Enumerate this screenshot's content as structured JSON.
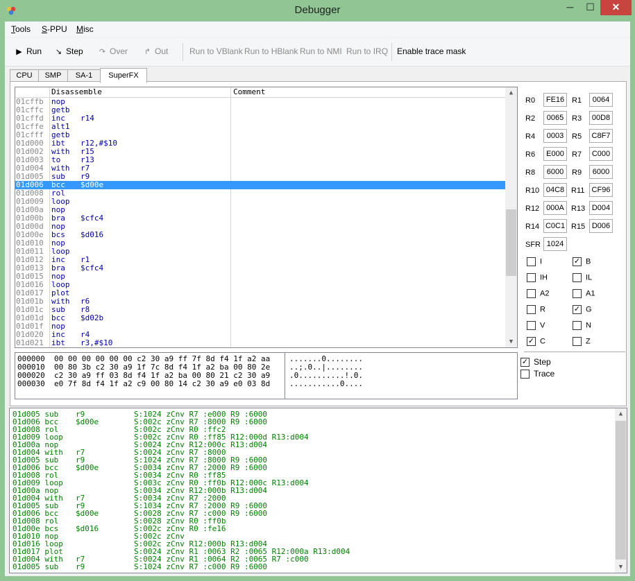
{
  "window": {
    "title": "Debugger",
    "min": "─",
    "max": "☐",
    "close": "✕"
  },
  "menu": [
    {
      "label": "Tools",
      "key": "T",
      "rest": "ools"
    },
    {
      "label": "S-PPU",
      "key": "S",
      "rest": "-PPU"
    },
    {
      "label": "Misc",
      "key": "M",
      "rest": "isc"
    }
  ],
  "toolbar": [
    {
      "label": "Run",
      "icon": "play-icon",
      "glyph": "▶",
      "enabled": true
    },
    {
      "label": "Step",
      "icon": "step-icon",
      "glyph": "↘",
      "enabled": true
    },
    {
      "label": "Over",
      "icon": "step-over-icon",
      "glyph": "↷",
      "enabled": false
    },
    {
      "label": "Out",
      "icon": "step-out-icon",
      "glyph": "↱",
      "enabled": false
    },
    {
      "label": "Run to VBlank",
      "enabled": false
    },
    {
      "label": "Run to HBlank",
      "enabled": false
    },
    {
      "label": "Run to NMI",
      "enabled": false
    },
    {
      "label": "Run to IRQ",
      "enabled": false
    },
    {
      "label": "Enable trace mask",
      "enabled": true
    }
  ],
  "tabs": [
    "CPU",
    "SMP",
    "SA-1",
    "SuperFX"
  ],
  "active_tab": "SuperFX",
  "disassembly": {
    "columns": [
      "Disassemble",
      "Comment"
    ],
    "selected_index": 10,
    "rows": [
      {
        "addr": "01cffb",
        "mn": "nop",
        "op": ""
      },
      {
        "addr": "01cffc",
        "mn": "getb",
        "op": ""
      },
      {
        "addr": "01cffd",
        "mn": "inc",
        "op": "r14"
      },
      {
        "addr": "01cffe",
        "mn": "alt1",
        "op": ""
      },
      {
        "addr": "01cfff",
        "mn": "getb",
        "op": ""
      },
      {
        "addr": "01d000",
        "mn": "ibt",
        "op": "r12,#$10"
      },
      {
        "addr": "01d002",
        "mn": "with",
        "op": "r15"
      },
      {
        "addr": "01d003",
        "mn": "to",
        "op": "r13"
      },
      {
        "addr": "01d004",
        "mn": "with",
        "op": "r7"
      },
      {
        "addr": "01d005",
        "mn": "sub",
        "op": "r9"
      },
      {
        "addr": "01d006",
        "mn": "bcc",
        "op": "$d00e"
      },
      {
        "addr": "01d008",
        "mn": "rol",
        "op": ""
      },
      {
        "addr": "01d009",
        "mn": "loop",
        "op": ""
      },
      {
        "addr": "01d00a",
        "mn": "nop",
        "op": ""
      },
      {
        "addr": "01d00b",
        "mn": "bra",
        "op": "$cfc4"
      },
      {
        "addr": "01d00d",
        "mn": "nop",
        "op": ""
      },
      {
        "addr": "01d00e",
        "mn": "bcs",
        "op": "$d016"
      },
      {
        "addr": "01d010",
        "mn": "nop",
        "op": ""
      },
      {
        "addr": "01d011",
        "mn": "loop",
        "op": ""
      },
      {
        "addr": "01d012",
        "mn": "inc",
        "op": "r1"
      },
      {
        "addr": "01d013",
        "mn": "bra",
        "op": "$cfc4"
      },
      {
        "addr": "01d015",
        "mn": "nop",
        "op": ""
      },
      {
        "addr": "01d016",
        "mn": "loop",
        "op": ""
      },
      {
        "addr": "01d017",
        "mn": "plot",
        "op": ""
      },
      {
        "addr": "01d01b",
        "mn": "with",
        "op": "r6"
      },
      {
        "addr": "01d01c",
        "mn": "sub",
        "op": "r8"
      },
      {
        "addr": "01d01d",
        "mn": "bcc",
        "op": "$d02b"
      },
      {
        "addr": "01d01f",
        "mn": "nop",
        "op": ""
      },
      {
        "addr": "01d020",
        "mn": "inc",
        "op": "r4"
      },
      {
        "addr": "01d021",
        "mn": "ibt",
        "op": "r3,#$10"
      }
    ]
  },
  "hexdump": [
    {
      "hex": "000000  00 00 00 00 00 00 c2 30 a9 ff 7f 8d f4 1f a2 aa",
      "ascii": ".......0........"
    },
    {
      "hex": "000010  00 80 3b c2 30 a9 1f 7c 8d f4 1f a2 ba 00 80 2e",
      "ascii": "..;.0..|........"
    },
    {
      "hex": "000020  c2 30 a9 ff 03 8d f4 1f a2 ba 00 80 21 c2 30 a9",
      "ascii": ".0..........!.0."
    },
    {
      "hex": "000030  e0 7f 8d f4 1f a2 c9 00 80 14 c2 30 a9 e0 03 8d",
      "ascii": "...........0...."
    }
  ],
  "registers": [
    [
      "R0",
      "FE16"
    ],
    [
      "R1",
      "0064"
    ],
    [
      "R2",
      "0065"
    ],
    [
      "R3",
      "00D8"
    ],
    [
      "R4",
      "0003"
    ],
    [
      "R5",
      "C8F7"
    ],
    [
      "R6",
      "E000"
    ],
    [
      "R7",
      "C000"
    ],
    [
      "R8",
      "6000"
    ],
    [
      "R9",
      "6000"
    ],
    [
      "R10",
      "04C8"
    ],
    [
      "R11",
      "CF96"
    ],
    [
      "R12",
      "000A"
    ],
    [
      "R13",
      "D004"
    ],
    [
      "R14",
      "C0C1"
    ],
    [
      "R15",
      "D006"
    ]
  ],
  "sfr": {
    "label": "SFR",
    "value": "1024"
  },
  "flags": [
    {
      "label": "I",
      "checked": false
    },
    {
      "label": "B",
      "checked": true
    },
    {
      "label": "IH",
      "checked": false
    },
    {
      "label": "IL",
      "checked": false
    },
    {
      "label": "A2",
      "checked": false
    },
    {
      "label": "A1",
      "checked": false
    },
    {
      "label": "R",
      "checked": false
    },
    {
      "label": "G",
      "checked": true
    },
    {
      "label": "V",
      "checked": false
    },
    {
      "label": "N",
      "checked": false
    },
    {
      "label": "C",
      "checked": true
    },
    {
      "label": "Z",
      "checked": false
    }
  ],
  "options": [
    {
      "label": "Step",
      "checked": true
    },
    {
      "label": "Trace",
      "checked": false
    }
  ],
  "trace_log": [
    [
      "01d005 sub",
      "r9",
      "S:1024 zCnv R7 :e000 R9 :6000"
    ],
    [
      "01d006 bcc",
      "$d00e",
      "S:002c zCnv R7 :8000 R9 :6000"
    ],
    [
      "01d008 rol",
      "",
      "S:002c zCnv R0 :ffc2"
    ],
    [
      "01d009 loop",
      "",
      "S:002c zCnv R0 :ff85 R12:000d R13:d004"
    ],
    [
      "01d00a nop",
      "",
      "S:0024 zCnv R12:000c R13:d004"
    ],
    [
      "01d004 with",
      "r7",
      "S:0024 zCnv R7 :8000"
    ],
    [
      "01d005 sub",
      "r9",
      "S:1024 zCnv R7 :8000 R9 :6000"
    ],
    [
      "01d006 bcc",
      "$d00e",
      "S:0034 zCnv R7 :2000 R9 :6000"
    ],
    [
      "01d008 rol",
      "",
      "S:0034 zCnv R0 :ff85"
    ],
    [
      "01d009 loop",
      "",
      "S:003c zCnv R0 :ff0b R12:000c R13:d004"
    ],
    [
      "01d00a nop",
      "",
      "S:0034 zCnv R12:000b R13:d004"
    ],
    [
      "01d004 with",
      "r7",
      "S:0034 zCnv R7 :2000"
    ],
    [
      "01d005 sub",
      "r9",
      "S:1034 zCnv R7 :2000 R9 :6000"
    ],
    [
      "01d006 bcc",
      "$d00e",
      "S:0028 zCnv R7 :c000 R9 :6000"
    ],
    [
      "01d008 rol",
      "",
      "S:0028 zCnv R0 :ff0b"
    ],
    [
      "01d00e bcs",
      "$d016",
      "S:002c zCnv R0 :fe16"
    ],
    [
      "01d010 nop",
      "",
      "S:002c zCnv"
    ],
    [
      "01d016 loop",
      "",
      "S:002c zCnv R12:000b R13:d004"
    ],
    [
      "01d017 plot",
      "",
      "S:0024 zCnv R1 :0063 R2 :0065 R12:000a R13:d004"
    ],
    [
      "01d004 with",
      "r7",
      "S:0024 zCnv R1 :0064 R2 :0065 R7 :c000"
    ],
    [
      "01d005 sub",
      "r9",
      "S:1024 zCnv R7 :c000 R9 :6000"
    ]
  ],
  "colors": {
    "titlebar": "#8fc694",
    "selection": "#3399ff",
    "trace_text": "#008000",
    "mnemonic": "#0000aa",
    "close": "#c7453e"
  }
}
